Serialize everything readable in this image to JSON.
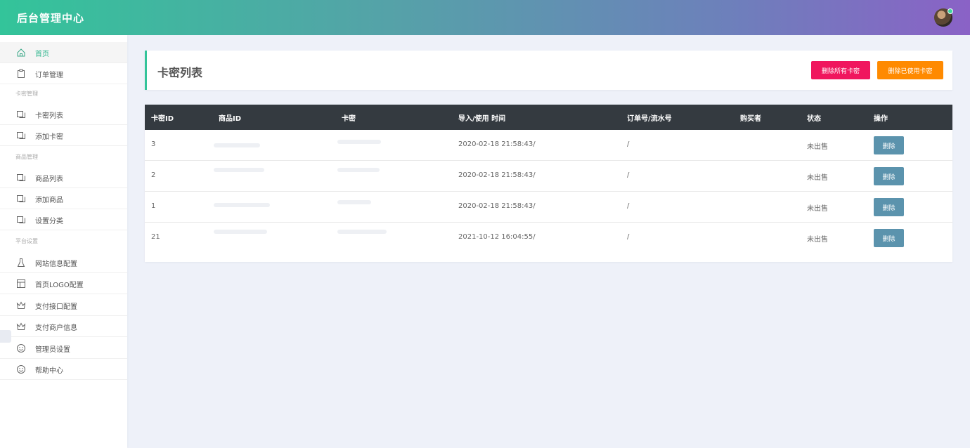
{
  "header": {
    "title": "后台管理中心"
  },
  "sidebar": {
    "groups": [
      "卡密管理",
      "商品管理",
      "平台设置"
    ],
    "items": [
      {
        "label": "首页",
        "icon": "home-icon"
      },
      {
        "label": "订单管理",
        "icon": "clipboard-icon"
      },
      {
        "label": "卡密列表",
        "icon": "copy-icon"
      },
      {
        "label": "添加卡密",
        "icon": "copy-icon"
      },
      {
        "label": "商品列表",
        "icon": "copy-icon"
      },
      {
        "label": "添加商品",
        "icon": "copy-icon"
      },
      {
        "label": "设置分类",
        "icon": "copy-icon"
      },
      {
        "label": "网站信息配置",
        "icon": "flask-icon"
      },
      {
        "label": "首页LOGO配置",
        "icon": "layout-icon"
      },
      {
        "label": "支付接口配置",
        "icon": "crown-icon"
      },
      {
        "label": "支付商户信息",
        "icon": "crown-icon"
      },
      {
        "label": "管理员设置",
        "icon": "smile-icon"
      },
      {
        "label": "帮助中心",
        "icon": "smile-icon"
      }
    ]
  },
  "page": {
    "title": "卡密列表",
    "delete_all_label": "删除所有卡密",
    "delete_used_label": "删除已使用卡密"
  },
  "table": {
    "columns": [
      "卡密ID",
      "商品ID",
      "卡密",
      "导入/使用 时间",
      "订单号/流水号",
      "购买者",
      "状态",
      "操作"
    ],
    "rows": [
      {
        "id": "3",
        "time": "2020-02-18 21:58:43/",
        "order": "/",
        "status": "未出售",
        "action": "删除"
      },
      {
        "id": "2",
        "time": "2020-02-18 21:58:43/",
        "order": "/",
        "status": "未出售",
        "action": "删除"
      },
      {
        "id": "1",
        "time": "2020-02-18 21:58:43/",
        "order": "/",
        "status": "未出售",
        "action": "删除"
      },
      {
        "id": "21",
        "time": "2021-10-12 16:04:55/",
        "order": "/",
        "status": "未出售",
        "action": "删除"
      }
    ]
  },
  "colors": {
    "accent": "#33c49a",
    "header_dark": "#343a40",
    "danger": "#f0165e",
    "warning": "#ff8a00",
    "row_button": "#5b93ad"
  }
}
